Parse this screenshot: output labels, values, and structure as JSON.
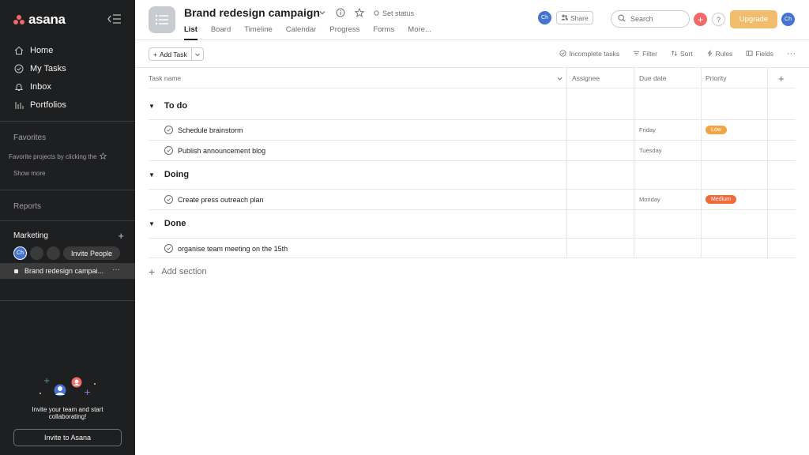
{
  "app": {
    "logo": "asana"
  },
  "sidebar": {
    "nav": [
      {
        "label": "Home",
        "icon": "home-icon"
      },
      {
        "label": "My Tasks",
        "icon": "check-circle-icon"
      },
      {
        "label": "Inbox",
        "icon": "bell-icon"
      },
      {
        "label": "Portfolios",
        "icon": "bar-chart-icon"
      }
    ],
    "favorites_title": "Favorites",
    "favorites_hint": "Favorite projects by clicking the",
    "show_more": "Show more",
    "reports_title": "Reports",
    "team_name": "Marketing",
    "member_initials": "Ch",
    "invite_people": "Invite People",
    "project_name": "Brand redesign campai...",
    "project_more": "···",
    "invite_text": "Invite your team and start collaborating!",
    "invite_button": "Invite to Asana"
  },
  "header": {
    "title": "Brand redesign campaign",
    "set_status": "Set status",
    "tabs": [
      "List",
      "Board",
      "Timeline",
      "Calendar",
      "Progress",
      "Forms",
      "More..."
    ],
    "avatar_initials": "Ch",
    "share": "Share",
    "search_placeholder": "Search",
    "help": "?",
    "upgrade": "Upgrade"
  },
  "toolbar": {
    "add_task": "Add Task",
    "incomplete": "Incomplete tasks",
    "filter": "Filter",
    "sort": "Sort",
    "rules": "Rules",
    "fields": "Fields",
    "more": "···"
  },
  "table": {
    "columns": [
      "Task name",
      "Assignee",
      "Due date",
      "Priority"
    ],
    "sections": [
      {
        "name": "To do",
        "tasks": [
          {
            "name": "Schedule brainstorm",
            "due": "Friday",
            "priority": "Low",
            "priority_color": "#f1a544"
          },
          {
            "name": "Publish announcement blog",
            "due": "Tuesday",
            "priority": "",
            "priority_color": ""
          }
        ]
      },
      {
        "name": "Doing",
        "tasks": [
          {
            "name": "Create press outreach plan",
            "due": "Monday",
            "priority": "Medium",
            "priority_color": "#f06a3a"
          }
        ]
      },
      {
        "name": "Done",
        "tasks": [
          {
            "name": "organise team meeting on the 15th",
            "due": "",
            "priority": "",
            "priority_color": ""
          }
        ]
      }
    ],
    "add_section": "Add section"
  },
  "colors": {
    "accent": "#f06a6a",
    "upgrade": "#f1bd6c",
    "sidebar_bg": "#1e1f21",
    "avatar": "#4573d2"
  }
}
